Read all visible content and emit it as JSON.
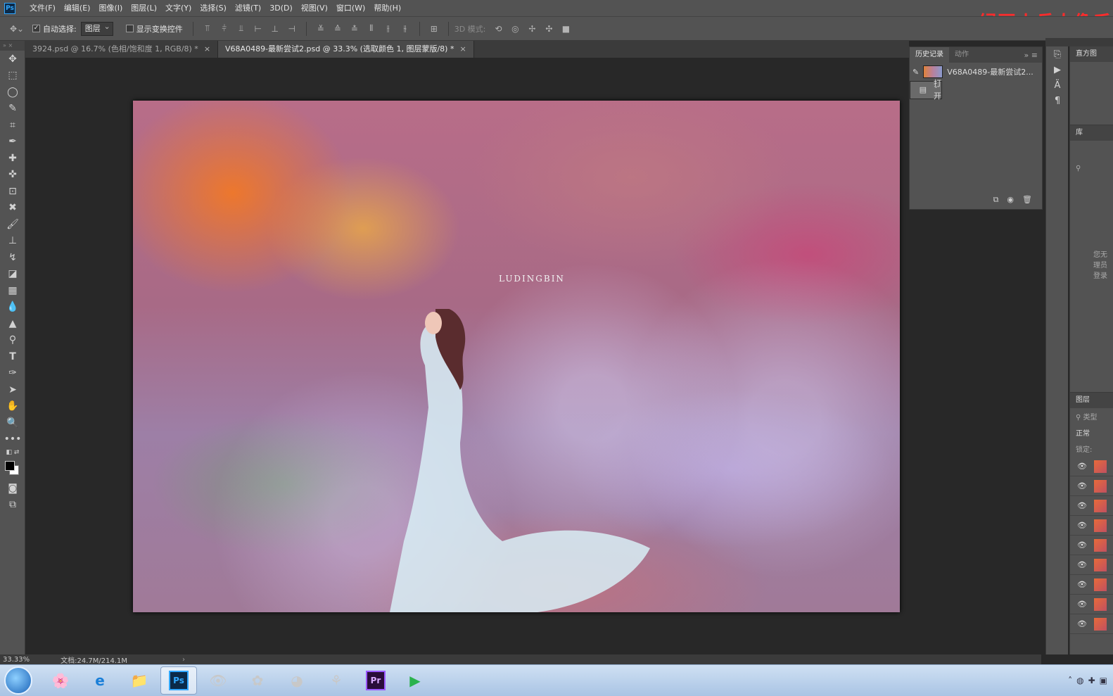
{
  "menubar": {
    "app_icon": "Ps",
    "items": [
      "文件(F)",
      "编辑(E)",
      "图像(I)",
      "图层(L)",
      "文字(Y)",
      "选择(S)",
      "滤镜(T)",
      "3D(D)",
      "视图(V)",
      "窗口(W)",
      "帮助(H)"
    ]
  },
  "watermark": "绿豆小兵人像后",
  "options": {
    "auto_select_label": "自动选择:",
    "auto_select_value": "图层",
    "show_transform_label": "显示变换控件",
    "mode_3d_label": "3D 模式:"
  },
  "tabs": [
    {
      "label": "3924.psd @ 16.7% (色相/饱和度 1, RGB/8) *",
      "close": "×"
    },
    {
      "label": "V68A0489-最新尝试2.psd @ 33.3% (选取颜色 1, 图层蒙版/8) *",
      "close": "×"
    }
  ],
  "photo_text": "LUDINGBIN",
  "status": {
    "zoom": "33.33%",
    "doc_size": "文档:24.7M/214.1M",
    "arrow": "›"
  },
  "history_panel": {
    "tabs": [
      "历史记录",
      "动作"
    ],
    "menu": "» ≡",
    "rows": [
      {
        "label": "V68A0489-最新尝试2..."
      },
      {
        "label": "打开"
      }
    ],
    "footer_icons": [
      "new-document-icon",
      "camera-icon",
      "trash-icon"
    ]
  },
  "right_panels": {
    "histogram_tab": "直方图",
    "library_tab": "库",
    "library_note": "您无\n理员\n登录",
    "layers_tab": "图层",
    "filter_kind": "类型",
    "blend_mode": "正常",
    "lock_label": "锁定:",
    "layer_count": 9
  },
  "colors": {
    "accent": "#31a8ff",
    "watermark": "#ff2b2b",
    "panel_bg": "#535353"
  },
  "taskbar": {
    "apps": [
      "windows-start",
      "photo-gallery",
      "internet-explorer",
      "file-explorer",
      "photoshop",
      "eye-app",
      "pinwheel-app",
      "color-wheel-app",
      "weibo-app",
      "premiere",
      "media-player"
    ],
    "ps_label": "Ps",
    "pr_label": "Pr"
  }
}
